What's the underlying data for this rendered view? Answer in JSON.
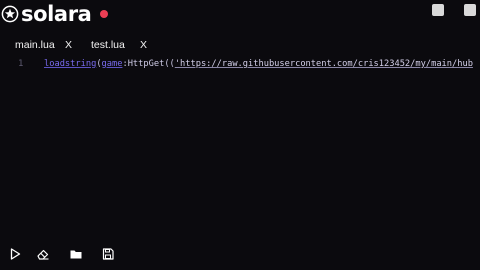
{
  "app": {
    "title": "solara",
    "logo_icon": "star-badge-icon",
    "status_color": "#ec3e54"
  },
  "window_controls": [
    {
      "name": "minimize-button",
      "icon": "square-icon"
    },
    {
      "name": "close-button",
      "icon": "square-icon"
    }
  ],
  "tabs": [
    {
      "label": "main.lua",
      "close": "X"
    },
    {
      "label": "test.lua",
      "close": "X"
    }
  ],
  "editor": {
    "line_number": "1",
    "code": {
      "fn": "loadstring",
      "paren_open": "(",
      "object": "game",
      "colon": ":",
      "method": "HttpGet",
      "paren_open2": "((",
      "string": "'https://raw.githubusercontent.com/cris123452/my/main/hub"
    }
  },
  "toolbar": [
    {
      "name": "execute-button",
      "icon": "play-icon"
    },
    {
      "name": "clear-button",
      "icon": "eraser-icon"
    },
    {
      "name": "open-file-button",
      "icon": "folder-icon"
    },
    {
      "name": "save-file-button",
      "icon": "save-icon"
    }
  ],
  "colors": {
    "background": "#0b0a0e",
    "accent": "#7a6cf0",
    "text": "#ffffff"
  }
}
